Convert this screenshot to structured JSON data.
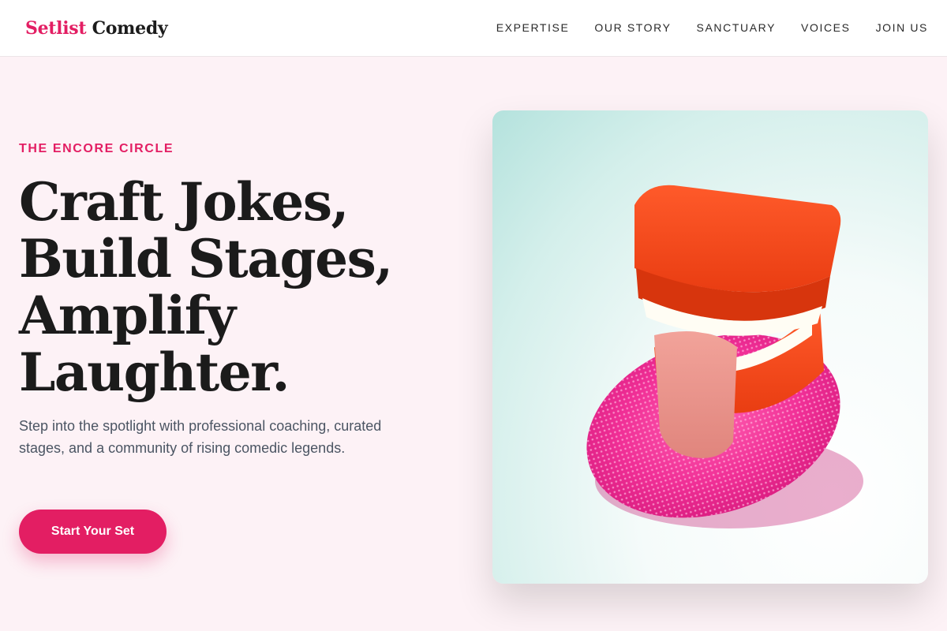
{
  "brand": {
    "accent": "Setlist",
    "rest": "Comedy"
  },
  "nav": {
    "items": [
      {
        "label": "EXPERTISE"
      },
      {
        "label": "OUR STORY"
      },
      {
        "label": "SANCTUARY"
      },
      {
        "label": "VOICES"
      },
      {
        "label": "JOIN US"
      }
    ]
  },
  "hero": {
    "eyebrow": "THE ENCORE CIRCLE",
    "headline": [
      "Craft Jokes,",
      "Build Stages,",
      "Amplify",
      "Laughter."
    ],
    "subtitle": "Step into the spotlight with professional coaching, curated stages, and a community of rising comedic legends.",
    "cta_label": "Start Your Set"
  },
  "image": {
    "icon": "wind-up-chattering-teeth-photo"
  },
  "colors": {
    "accent": "#e31e63",
    "background": "#fdf2f6",
    "text": "#1b1b1b",
    "muted": "#4b5563"
  }
}
